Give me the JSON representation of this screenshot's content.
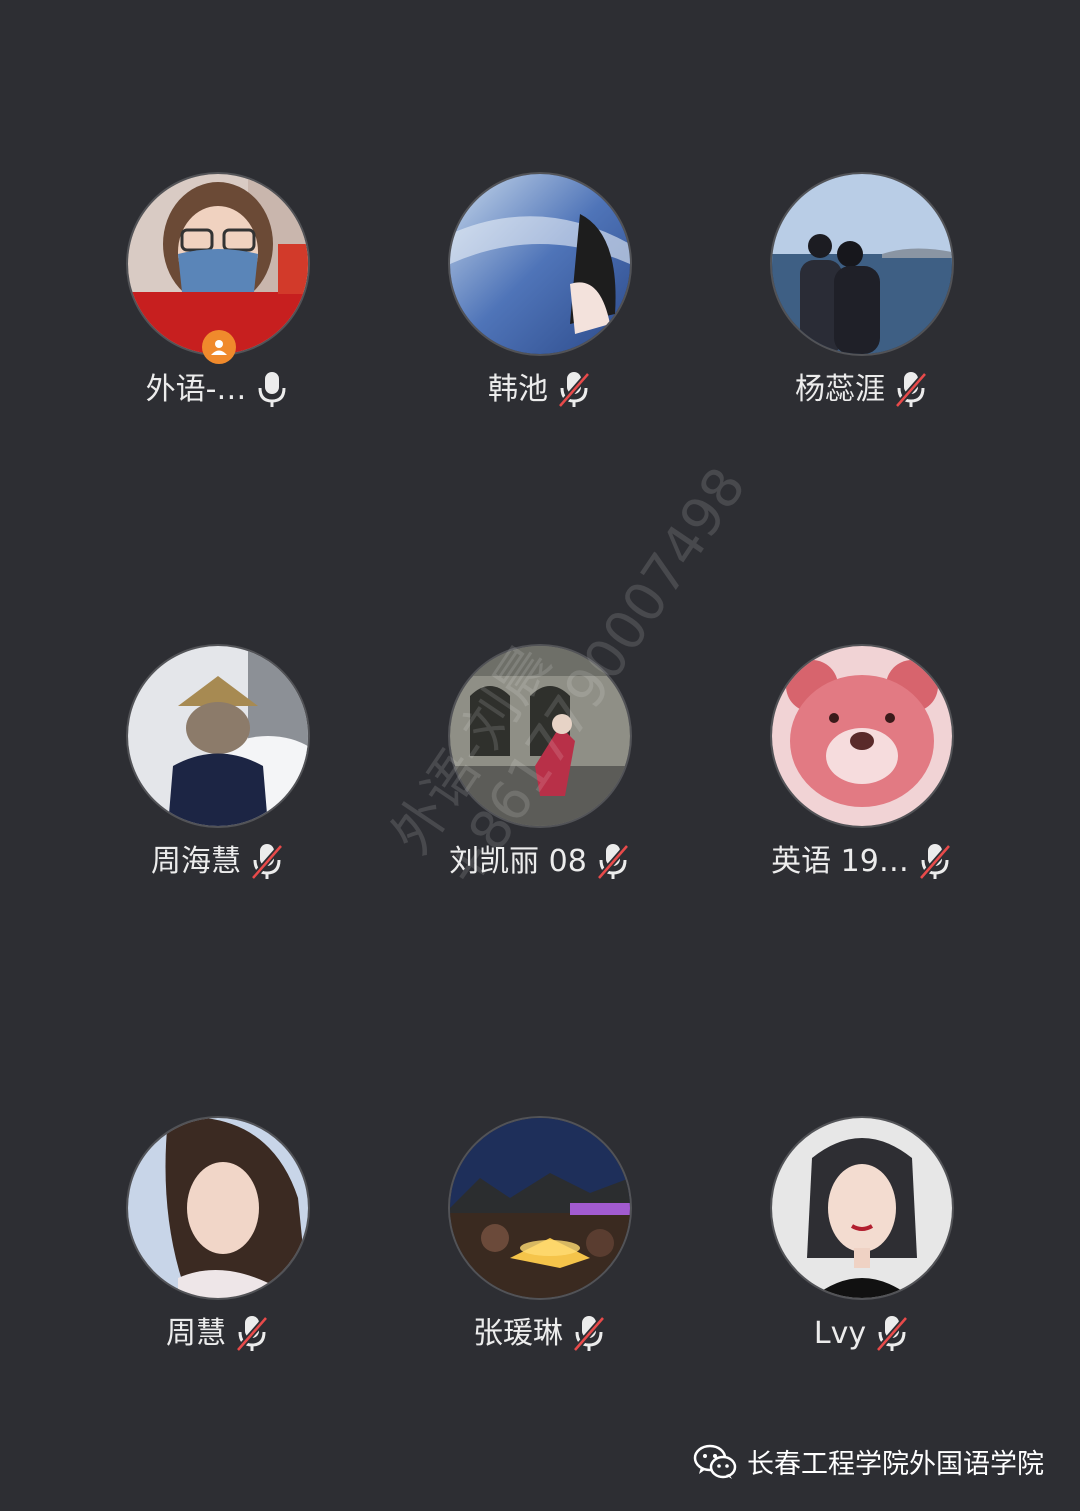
{
  "participants": [
    {
      "name": "外语-…",
      "mic": "on",
      "host": true
    },
    {
      "name": "韩池",
      "mic": "muted",
      "host": false
    },
    {
      "name": "杨蕊涯",
      "mic": "muted",
      "host": false
    },
    {
      "name": "周海慧",
      "mic": "muted",
      "host": false
    },
    {
      "name": "刘凯丽 08",
      "mic": "muted",
      "host": false
    },
    {
      "name": "英语 19…",
      "mic": "muted",
      "host": false
    },
    {
      "name": "周慧",
      "mic": "muted",
      "host": false
    },
    {
      "name": "张瑗琳",
      "mic": "muted",
      "host": false
    },
    {
      "name": "Lvy",
      "mic": "muted",
      "host": false
    }
  ],
  "watermark": {
    "line1": "外语-刘晨",
    "line2": "+8617790007498"
  },
  "footer": {
    "text": "长春工程学院外国语学院",
    "icon": "wechat-icon"
  },
  "colors": {
    "background": "#2d2e33",
    "mic_muted_slash": "#e84a4a",
    "host_badge": "#f08a2c"
  }
}
